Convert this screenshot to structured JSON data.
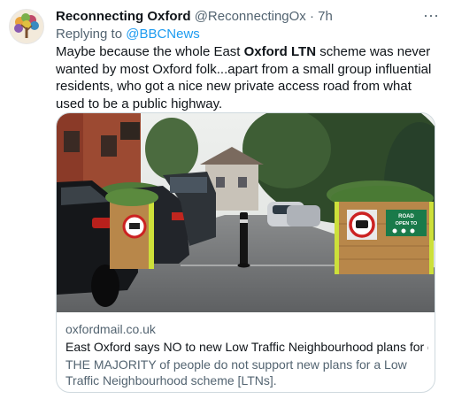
{
  "tweet": {
    "author_name": "Reconnecting Oxford",
    "handle": "@ReconnectingOx",
    "separator": "·",
    "time": "7h",
    "reply_prefix": "Replying to",
    "reply_to": "@BBCNews",
    "text_1": "Maybe because the whole East ",
    "text_bold": "Oxford LTN",
    "text_2": " scheme was never wanted by most Oxford folk...apart from a small group influential residents, who got a nice new private access road from what used to be a public highway.",
    "more_label": "···"
  },
  "card": {
    "domain": "oxfordmail.co.uk",
    "title": "East Oxford says NO to new Low Traffic Neighbourhood plans for c...",
    "description": "THE MAJORITY of people do not support new plans for a Low Traffic Neighbourhood scheme [LTNs].",
    "sign_text_1": "ROAD",
    "sign_text_2": "OPEN TO"
  },
  "colors": {
    "link": "#1d9bf0",
    "secondary_text": "#536471",
    "primary_text": "#0f1419",
    "border": "#cfd9de"
  }
}
